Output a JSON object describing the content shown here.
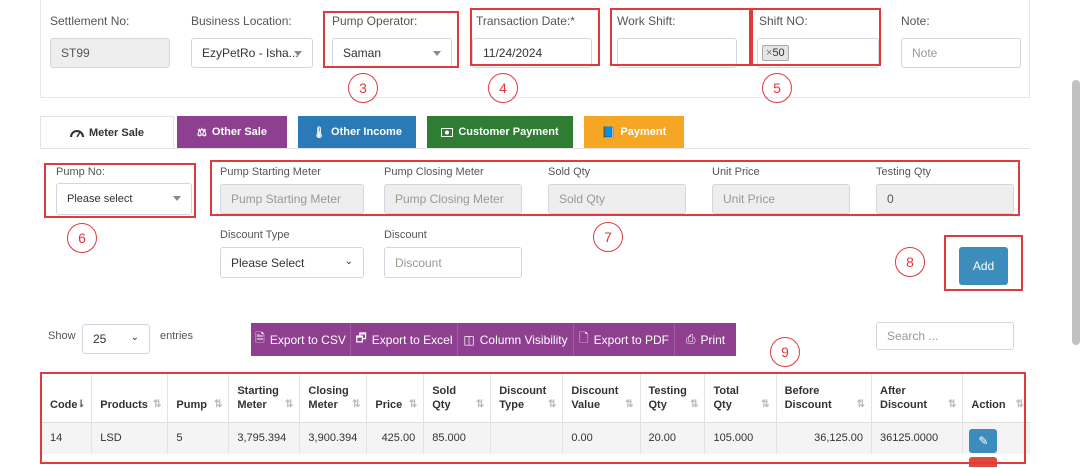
{
  "settlement": {
    "label": "Settlement No:",
    "value": "ST99"
  },
  "business_location": {
    "label": "Business Location:",
    "value": "EzyPetRo - Isha..."
  },
  "pump_operator": {
    "label": "Pump Operator:",
    "value": "Saman"
  },
  "transaction_date": {
    "label": "Transaction Date:*",
    "value": "11/24/2024"
  },
  "work_shift": {
    "label": "Work Shift:",
    "value": ""
  },
  "shift_no": {
    "label": "Shift NO:",
    "tag_remove": "×",
    "tag_value": "50"
  },
  "note": {
    "label": "Note:",
    "placeholder": "Note"
  },
  "tabs": [
    {
      "label": "Meter Sale",
      "icon": "tachometer-icon",
      "color": "#ffffff"
    },
    {
      "label": "Other Sale",
      "icon": "balance-scale-icon",
      "color": "#8f3f8f"
    },
    {
      "label": "Other Income",
      "icon": "thermometer-icon",
      "color": "#2a7ab8"
    },
    {
      "label": "Customer Payment",
      "icon": "money-icon",
      "color": "#2e7d32"
    },
    {
      "label": "Payment",
      "icon": "book-icon",
      "color": "#f5a623"
    }
  ],
  "pump_no": {
    "label": "Pump No:",
    "value": "Please select"
  },
  "meters": {
    "starting": {
      "label": "Pump Starting Meter",
      "placeholder": "Pump Starting Meter"
    },
    "closing": {
      "label": "Pump Closing Meter",
      "placeholder": "Pump Closing Meter"
    },
    "sold": {
      "label": "Sold Qty",
      "placeholder": "Sold Qty"
    },
    "unit_price": {
      "label": "Unit Price",
      "placeholder": "Unit Price"
    },
    "testing": {
      "label": "Testing Qty",
      "value": "0"
    }
  },
  "discount_type": {
    "label": "Discount Type",
    "value": "Please Select"
  },
  "discount": {
    "label": "Discount",
    "placeholder": "Discount"
  },
  "add_label": "Add",
  "annotations": [
    "3",
    "4",
    "5",
    "6",
    "7",
    "8",
    "9"
  ],
  "table_controls": {
    "show": "Show",
    "entries_value": "25",
    "entries": "entries",
    "search_placeholder": "Search ..."
  },
  "toolbar": [
    {
      "label": "Export to CSV",
      "icon": "file-icon"
    },
    {
      "label": "Export to Excel",
      "icon": "excel-icon"
    },
    {
      "label": "Column Visibility",
      "icon": "columns-icon"
    },
    {
      "label": "Export to PDF",
      "icon": "pdf-icon"
    },
    {
      "label": "Print",
      "icon": "print-icon"
    }
  ],
  "table": {
    "headers": [
      [
        "Code"
      ],
      [
        "Products"
      ],
      [
        "Pump"
      ],
      [
        "Starting",
        "Meter"
      ],
      [
        "Closing",
        "Meter"
      ],
      [
        "Price"
      ],
      [
        "Sold",
        "Qty"
      ],
      [
        "Discount",
        "Type"
      ],
      [
        "Discount",
        "Value"
      ],
      [
        "Testing",
        "Qty"
      ],
      [
        "Total",
        "Qty"
      ],
      [
        "Before",
        "Discount"
      ],
      [
        "After",
        "Discount"
      ],
      [
        "Action"
      ]
    ],
    "rows": [
      [
        "14",
        "LSD",
        "5",
        "3,795.394",
        "3,900.394",
        "425.00",
        "85.000",
        "",
        "0.00",
        "20.00",
        "105.000",
        "36,125.00",
        "36125.0000"
      ]
    ]
  },
  "colors": {
    "accent_red": "#e0393e",
    "add_button": "#3c8dbc",
    "toolbar": "#8f3f8f"
  }
}
